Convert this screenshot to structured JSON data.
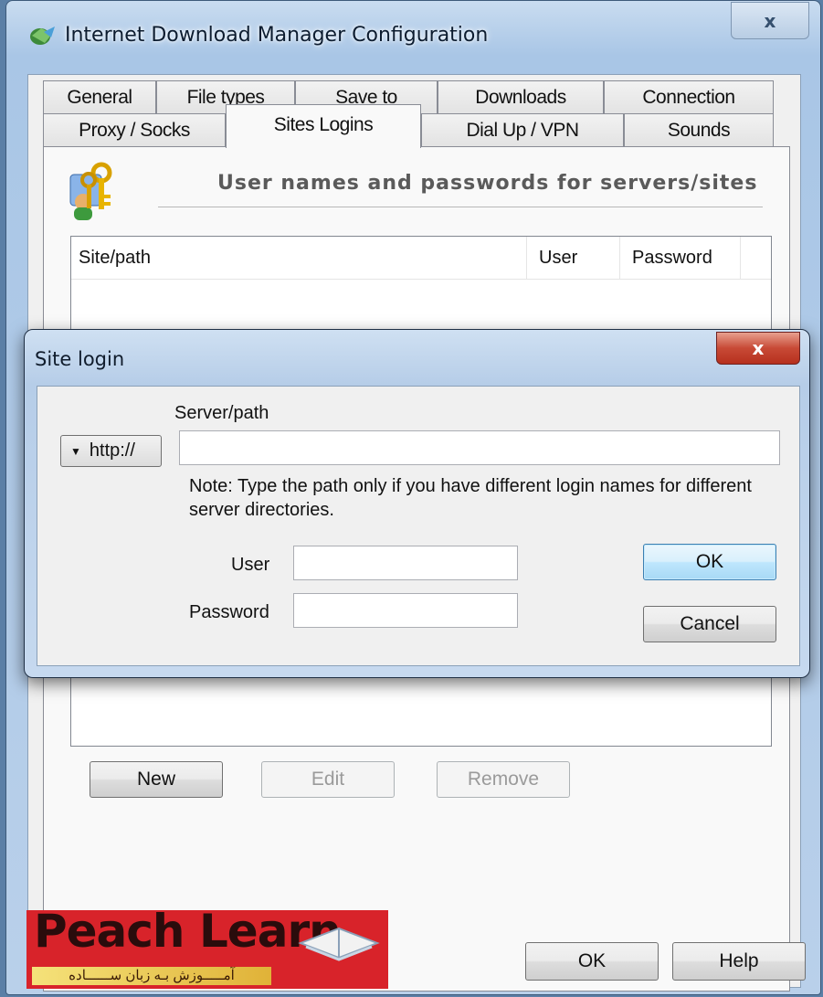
{
  "window": {
    "title": "Internet Download Manager Configuration",
    "close_glyph": "x"
  },
  "tabs": {
    "row1": [
      "General",
      "File types",
      "Save to",
      "Downloads",
      "Connection"
    ],
    "row2": [
      "Proxy / Socks",
      "Sites Logins",
      "Dial Up / VPN",
      "Sounds"
    ],
    "active": "Sites Logins"
  },
  "section": {
    "title": "User names and passwords for servers/sites",
    "icon": "keys-user-icon"
  },
  "list": {
    "columns": [
      "Site/path",
      "User",
      "Password"
    ],
    "rows": []
  },
  "buttons": {
    "new": "New",
    "edit": "Edit",
    "remove": "Remove",
    "ok": "OK",
    "help": "Help"
  },
  "dialog": {
    "title": "Site login",
    "close_glyph": "x",
    "server_label": "Server/path",
    "protocol": "http://",
    "server_value": "",
    "note": "Note: Type the path only if you have different login names for different server directories.",
    "user_label": "User",
    "user_value": "",
    "password_label": "Password",
    "password_value": "",
    "ok": "OK",
    "cancel": "Cancel"
  },
  "watermark": {
    "brand": "Peach Learn",
    "tagline": "آمـــــوزش بـه زبان ســــــاده"
  },
  "colors": {
    "accent": "#3c7fb1",
    "brand_red": "#d8232a",
    "dialog_close": "#c84a36"
  }
}
